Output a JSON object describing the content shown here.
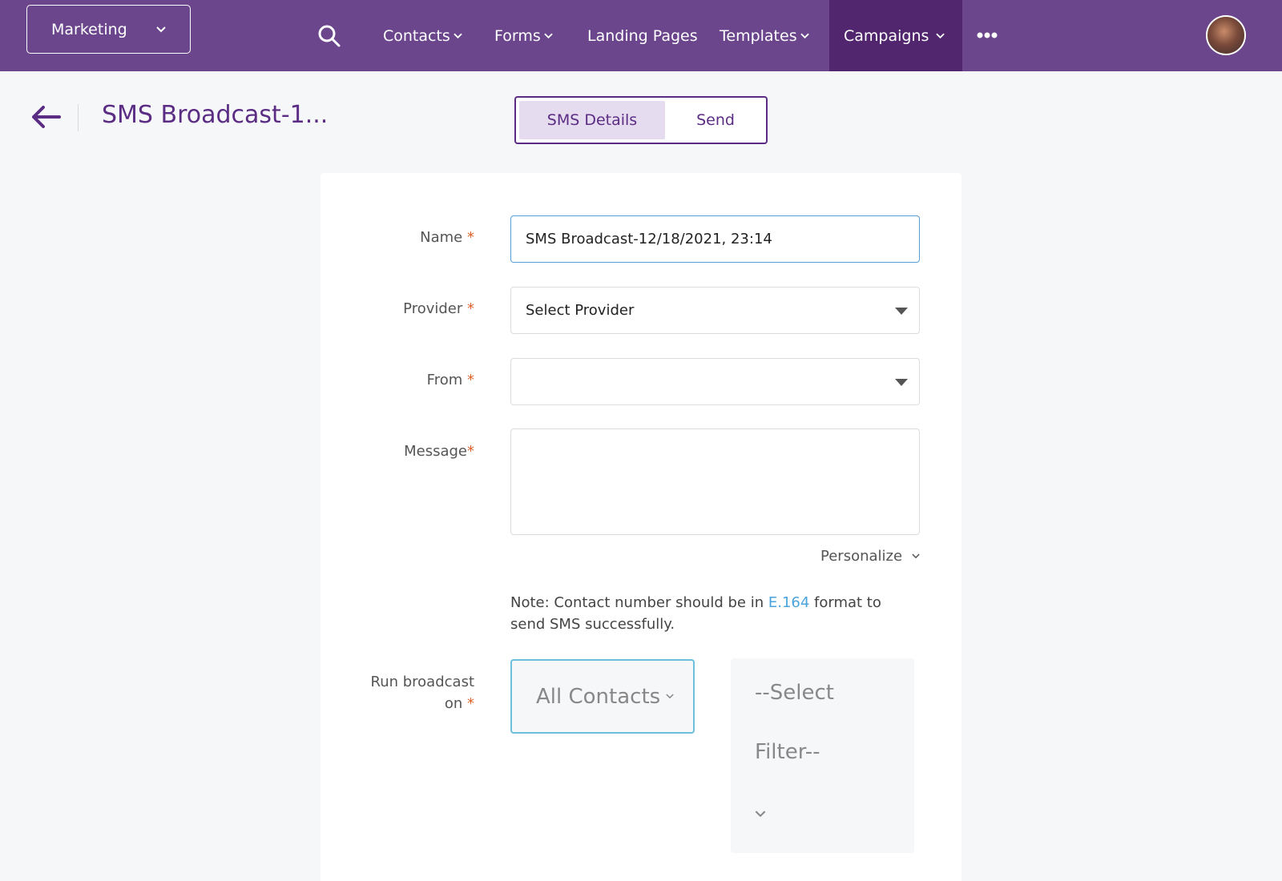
{
  "header": {
    "app_switcher": {
      "label": "Marketing"
    },
    "nav": {
      "contacts": "Contacts",
      "forms": "Forms",
      "landing_pages": "Landing Pages",
      "templates": "Templates",
      "campaigns": "Campaigns"
    },
    "active_nav": "Campaigns"
  },
  "page": {
    "title": "SMS Broadcast-1...",
    "tabs": {
      "details": "SMS Details",
      "send": "Send"
    },
    "active_tab": "SMS Details"
  },
  "form": {
    "name": {
      "label": "Name",
      "required": "*",
      "value": "SMS Broadcast-12/18/2021, 23:14"
    },
    "provider": {
      "label": "Provider",
      "required": "*",
      "value": "Select Provider"
    },
    "from": {
      "label": "From",
      "required": "*",
      "value": ""
    },
    "message": {
      "label": "Message",
      "required": "*",
      "value": ""
    },
    "personalize": "Personalize",
    "note": {
      "prefix": "Note: Contact number should be in ",
      "link": "E.164",
      "suffix": " format to send SMS successfully."
    },
    "run_broadcast": {
      "label_line1": "Run broadcast",
      "label_line2": "on",
      "required": "*",
      "segment": "All Contacts",
      "filter_line1": "--Select",
      "filter_line2": "Filter--"
    }
  },
  "colors": {
    "topbar": "#6b468d",
    "nav_active": "#51266f",
    "accent": "#5b2c83",
    "required": "#e0622a",
    "link": "#4aa3dc"
  },
  "icons": {
    "search": "search-icon",
    "more": "more-horizontal-icon",
    "back": "arrow-left-icon",
    "dropdown": "chevron-down-icon"
  }
}
